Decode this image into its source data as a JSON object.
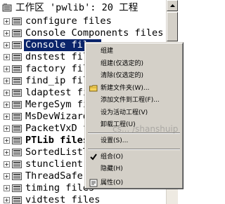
{
  "workspace": {
    "root_label": "工作区 'pwlib': 20 工程",
    "items": [
      {
        "label": "configure files",
        "bold": false,
        "selected": false
      },
      {
        "label": "Console Components files",
        "bold": false,
        "selected": false
      },
      {
        "label": "Console files",
        "bold": false,
        "selected": true
      },
      {
        "label": "dnstest files",
        "bold": false,
        "selected": false
      },
      {
        "label": "factory files",
        "bold": false,
        "selected": false
      },
      {
        "label": "find_ip files",
        "bold": false,
        "selected": false
      },
      {
        "label": "ldaptest files",
        "bold": false,
        "selected": false
      },
      {
        "label": "MergeSym files",
        "bold": false,
        "selected": false
      },
      {
        "label": "MsDevWizard files",
        "bold": false,
        "selected": false
      },
      {
        "label": "PacketVxD files",
        "bold": false,
        "selected": false
      },
      {
        "label": "PTLib files",
        "bold": true,
        "selected": false
      },
      {
        "label": "SortedListTest files",
        "bold": false,
        "selected": false
      },
      {
        "label": "stunclient files",
        "bold": false,
        "selected": false
      },
      {
        "label": "ThreadSafe files",
        "bold": false,
        "selected": false
      },
      {
        "label": "timing files",
        "bold": false,
        "selected": false
      },
      {
        "label": "vidtest files",
        "bold": false,
        "selected": false
      }
    ],
    "expander_glyph": "+"
  },
  "context_menu": {
    "items": [
      {
        "label": "组建",
        "icon": "",
        "checked": false
      },
      {
        "label": "组建(仅选定的)",
        "icon": "",
        "checked": false
      },
      {
        "label": "清除(仅选定的)",
        "icon": "",
        "checked": false
      },
      {
        "label": "新建文件夹(W)...",
        "icon": "new-folder-icon",
        "checked": false
      },
      {
        "label": "添加文件到工程(F)...",
        "icon": "",
        "checked": false
      },
      {
        "label": "设为活动工程(V)",
        "icon": "",
        "checked": false
      },
      {
        "label": "卸载工程(U)",
        "icon": "",
        "checked": false
      },
      {
        "label": "设置(S)...",
        "icon": "",
        "checked": false
      },
      {
        "label": "组合(O)",
        "icon": "checkmark-icon",
        "checked": true
      },
      {
        "label": "隐藏(H)",
        "icon": "",
        "checked": false
      },
      {
        "label": "属性(O)",
        "icon": "properties-icon",
        "checked": false
      }
    ]
  },
  "watermark": "cs... /shanshuip",
  "colors": {
    "selection": "#0a246a",
    "menu_bg": "#d4d0c8",
    "folder": "#5a5a5a"
  }
}
